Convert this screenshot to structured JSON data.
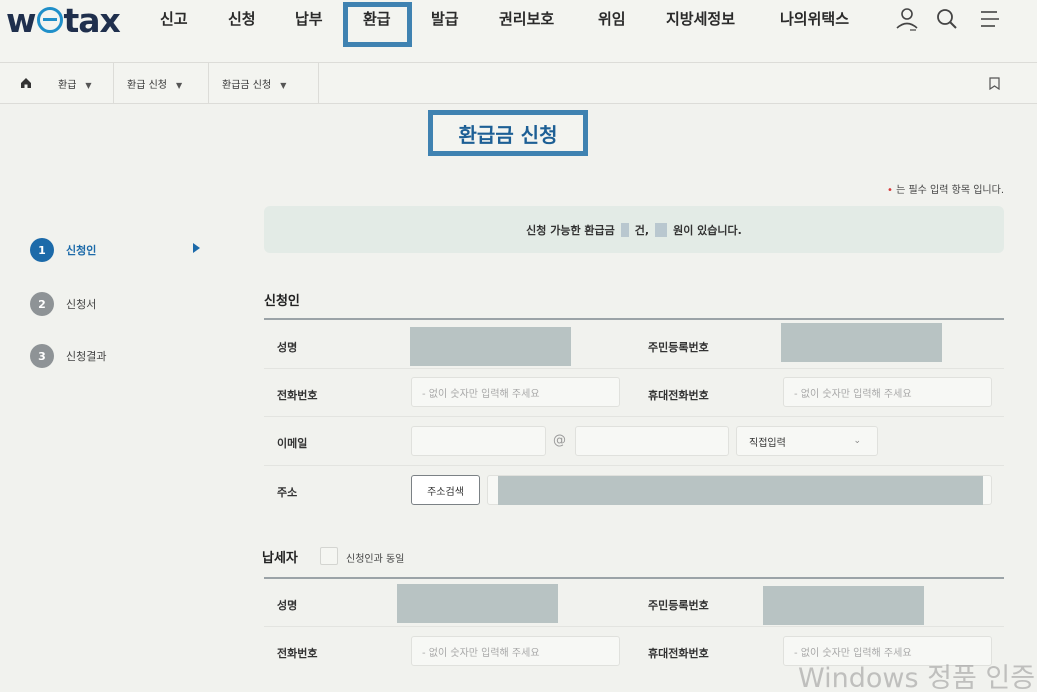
{
  "brand": {
    "logo_w": "w",
    "logo_rest": "tax"
  },
  "nav": {
    "items": [
      "신고",
      "신청",
      "납부",
      "환급",
      "발급",
      "권리보호",
      "위임",
      "지방세정보",
      "나의위택스"
    ],
    "active": "환급"
  },
  "header_icons": [
    "user-icon",
    "search-icon",
    "menu-icon"
  ],
  "breadcrumb": [
    "환급",
    "환급 신청",
    "환급금 신청"
  ],
  "page_title": "환급금 신청",
  "required_note": {
    "mark": "•",
    "text": " 는 필수 입력 항목 입니다."
  },
  "info_banner": {
    "part1": "신청 가능한 환급금",
    "part2": "건,",
    "part3": "원이 있습니다."
  },
  "steps": [
    {
      "num": "1",
      "label": "신청인",
      "active": true
    },
    {
      "num": "2",
      "label": "신청서",
      "active": false
    },
    {
      "num": "3",
      "label": "신청결과",
      "active": false
    }
  ],
  "applicant": {
    "section_title": "신청인",
    "name_label": "성명",
    "rrn_label": "주민등록번호",
    "phone_label": "전화번호",
    "phone_placeholder": "- 없이 숫자만 입력해 주세요",
    "mobile_label": "휴대전화번호",
    "mobile_placeholder": "- 없이 숫자만 입력해 주세요",
    "email_label": "이메일",
    "email_at": "@",
    "email_domain_select": "직접입력",
    "address_label": "주소",
    "address_button": "주소검색"
  },
  "taxpayer": {
    "section_title": "납세자",
    "same_as_applicant": "신청인과 동일",
    "name_label": "성명",
    "rrn_label": "주민등록번호",
    "phone_label": "전화번호",
    "phone_placeholder": "- 없이 숫자만 입력해 주세요",
    "mobile_label": "휴대전화번호",
    "mobile_placeholder": "- 없이 숫자만 입력해 주세요"
  },
  "watermark": "Windows 정품 인증",
  "colors": {
    "accent": "#1c6aa9",
    "highlight": "#3f82b1",
    "brand_navy": "#1f2f4d"
  }
}
